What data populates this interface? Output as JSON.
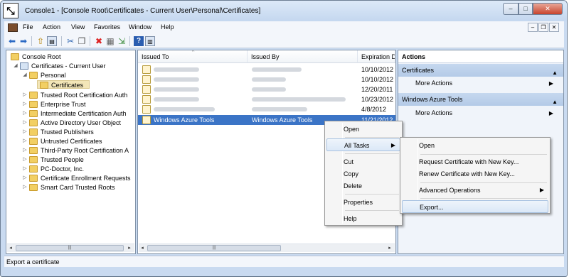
{
  "window": {
    "title": "Console1 - [Console Root\\Certificates - Current User\\Personal\\Certificates]",
    "min_glyph": "–",
    "max_glyph": "□",
    "close_glyph": "✕"
  },
  "menubar": {
    "items": [
      "File",
      "Action",
      "View",
      "Favorites",
      "Window",
      "Help"
    ],
    "mdi_min": "–",
    "mdi_restore": "❐",
    "mdi_close": "✕"
  },
  "toolbar": {
    "icons": [
      "back-arrow-icon",
      "forward-arrow-icon",
      "up-folder-icon",
      "show-hide-tree-icon",
      "cut-icon",
      "copy-icon",
      "delete-icon",
      "properties-icon",
      "export-list-icon",
      "help-icon",
      "show-hide-action-pane-icon"
    ]
  },
  "tree": {
    "root": "Console Root",
    "current_user": "Certificates - Current User",
    "personal": "Personal",
    "certificates": "Certificates",
    "stores": [
      "Trusted Root Certification Auth",
      "Enterprise Trust",
      "Intermediate Certification Auth",
      "Active Directory User Object",
      "Trusted Publishers",
      "Untrusted Certificates",
      "Third-Party Root Certification A",
      "Trusted People",
      "PC-Doctor, Inc.",
      "Certificate Enrollment Requests",
      "Smart Card Trusted Roots"
    ],
    "scroll_thumb": "|||"
  },
  "list": {
    "headers": [
      "Issued To",
      "Issued By",
      "Expiration D"
    ],
    "sort_glyph": "^",
    "rows": [
      {
        "expiration": "10/10/2012"
      },
      {
        "expiration": "10/10/2012"
      },
      {
        "expiration": "12/20/2011"
      },
      {
        "expiration": "10/23/2012"
      },
      {
        "expiration": "4/8/2012"
      }
    ],
    "selected": {
      "issued_to": "Windows Azure Tools",
      "issued_by": "Windows Azure Tools",
      "expiration": "11/21/2012"
    },
    "scroll_thumb": "|||"
  },
  "actions": {
    "title": "Actions",
    "sections": [
      {
        "label": "Certificates",
        "more": "More Actions"
      },
      {
        "label": "Windows Azure Tools",
        "more": "More Actions"
      }
    ]
  },
  "context_menu": {
    "items": [
      "Open",
      "All Tasks",
      "Cut",
      "Copy",
      "Delete",
      "Properties",
      "Help"
    ]
  },
  "submenu": {
    "items": [
      "Open",
      "Request Certificate with New Key...",
      "Renew Certificate with New Key...",
      "Advanced Operations",
      "Export..."
    ]
  },
  "status": {
    "text": "Export a certificate"
  },
  "colors": {
    "selection": "#3b74c6",
    "action_section": "#bcd0ea",
    "folder": "#f2cf63"
  }
}
